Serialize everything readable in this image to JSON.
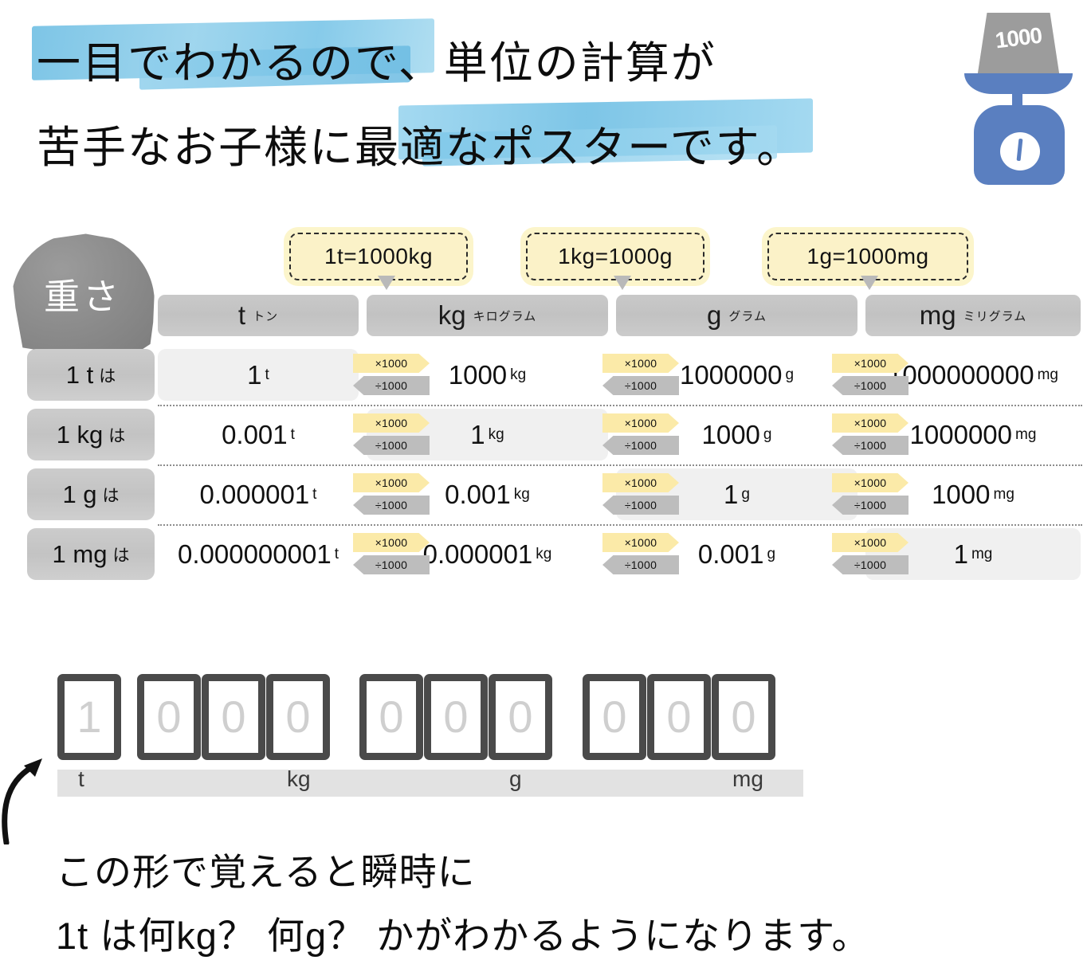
{
  "header": {
    "line1": "一目でわかるので、単位の計算が",
    "line2": "苦手なお子様に最適なポスターです。",
    "illustration": {
      "name": "kitchen-scale",
      "weight_label": "1000"
    }
  },
  "table": {
    "category_label": "重さ",
    "callouts": [
      {
        "text": "1t=1000kg"
      },
      {
        "text": "1kg=1000g"
      },
      {
        "text": "1g=1000mg"
      }
    ],
    "columns": [
      {
        "symbol": "t",
        "kana": "トン"
      },
      {
        "symbol": "kg",
        "kana": "キログラム"
      },
      {
        "symbol": "g",
        "kana": "グラム"
      },
      {
        "symbol": "mg",
        "kana": "ミリグラム"
      }
    ],
    "badge_multiply": "×1000",
    "badge_divide": "÷1000",
    "rows": [
      {
        "label_value": "1 t",
        "label_suffix": "は",
        "cells": [
          {
            "value": "1",
            "unit": "t",
            "highlight": true
          },
          {
            "value": "1000",
            "unit": "kg",
            "highlight": false
          },
          {
            "value": "1000000",
            "unit": "g",
            "highlight": false
          },
          {
            "value": "1000000000",
            "unit": "mg",
            "highlight": false
          }
        ]
      },
      {
        "label_value": "1 kg",
        "label_suffix": "は",
        "cells": [
          {
            "value": "0.001",
            "unit": "t",
            "highlight": false
          },
          {
            "value": "1",
            "unit": "kg",
            "highlight": true
          },
          {
            "value": "1000",
            "unit": "g",
            "highlight": false
          },
          {
            "value": "1000000",
            "unit": "mg",
            "highlight": false
          }
        ]
      },
      {
        "label_value": "1 g",
        "label_suffix": "は",
        "cells": [
          {
            "value": "0.000001",
            "unit": "t",
            "highlight": false
          },
          {
            "value": "0.001",
            "unit": "kg",
            "highlight": false
          },
          {
            "value": "1",
            "unit": "g",
            "highlight": true
          },
          {
            "value": "1000",
            "unit": "mg",
            "highlight": false
          }
        ]
      },
      {
        "label_value": "1 mg",
        "label_suffix": "は",
        "cells": [
          {
            "value": "0.000000001",
            "unit": "t",
            "highlight": false
          },
          {
            "value": "0.000001",
            "unit": "kg",
            "highlight": false
          },
          {
            "value": "0.001",
            "unit": "g",
            "highlight": false
          },
          {
            "value": "1",
            "unit": "mg",
            "highlight": true
          }
        ]
      }
    ]
  },
  "digit_strip": {
    "digits": [
      "1",
      "0",
      "0",
      "0",
      "0",
      "0",
      "0",
      "0",
      "0",
      "0"
    ],
    "unit_markers": [
      {
        "label": "t",
        "digit_index": 0
      },
      {
        "label": "kg",
        "digit_index": 3
      },
      {
        "label": "g",
        "digit_index": 6
      },
      {
        "label": "mg",
        "digit_index": 9
      }
    ]
  },
  "footer": {
    "line1": "この形で覚えると瞬時に",
    "line2": "1t は何kg？ 何g？ かがわかるようになります。"
  },
  "colors": {
    "highlight_blue": "#7cc6e8",
    "callout_yellow": "#fbf2c8",
    "badge_multiply": "#fbeaa8",
    "badge_divide": "#bdbdbd",
    "header_cell_gray": "#c5c5c5",
    "scale_blue": "#5a7fc0",
    "stone_gray": "#8a8a8a"
  }
}
